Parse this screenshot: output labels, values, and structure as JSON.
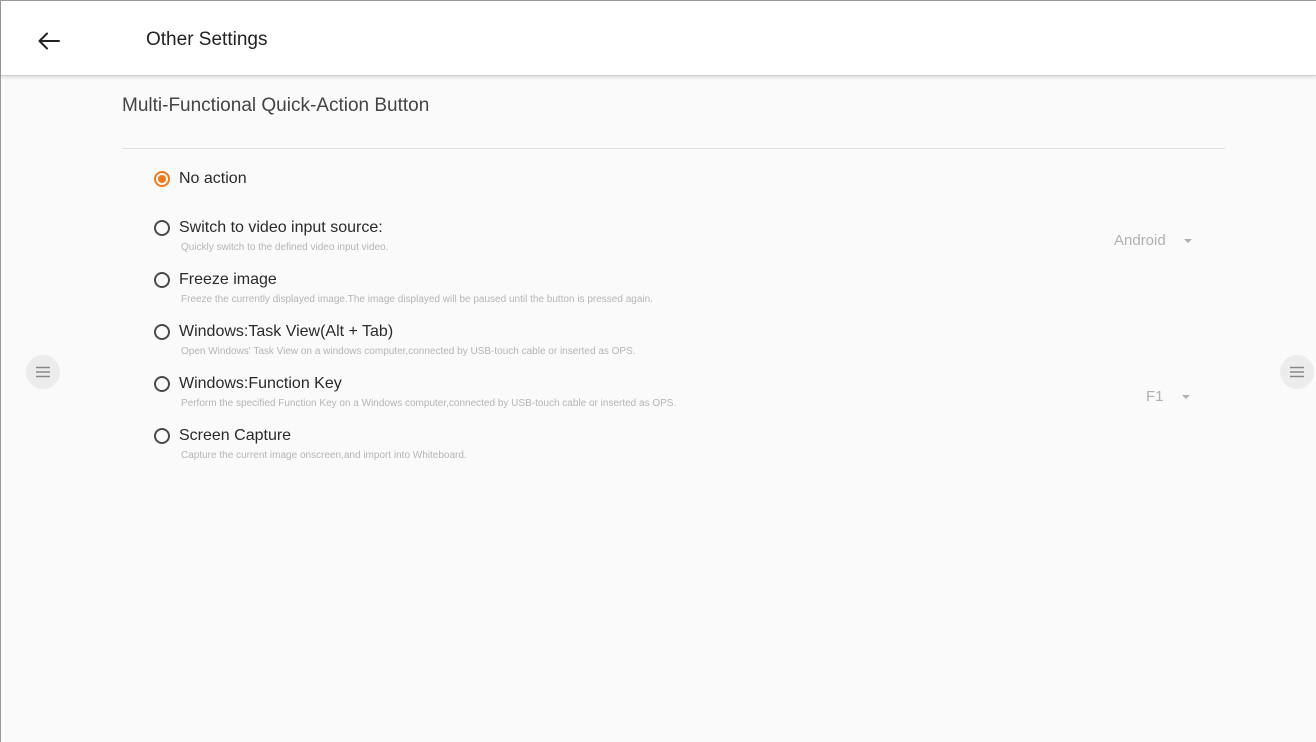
{
  "header": {
    "title": "Other Settings",
    "back_icon": "arrow-left-icon"
  },
  "section": {
    "title": "Multi-Functional Quick-Action Button"
  },
  "options": [
    {
      "label": "No action",
      "description": "",
      "selected": true
    },
    {
      "label": "Switch to video input source:",
      "description": "Quickly switch to the defined video input video.",
      "selected": false
    },
    {
      "label": "Freeze image",
      "description": "Freeze the currently displayed image.The image displayed will be paused until the button is pressed again.",
      "selected": false
    },
    {
      "label": "Windows:Task View(Alt + Tab)",
      "description": "Open Windows' Task View on a windows computer,connected by USB-touch cable or inserted as OPS.",
      "selected": false
    },
    {
      "label": "Windows:Function Key",
      "description": "Perform the specified Function Key on a Windows computer,connected by USB-touch cable or inserted as OPS.",
      "selected": false
    },
    {
      "label": "Screen Capture",
      "description": "Capture the current image onscreen,and import into Whiteboard.",
      "selected": false
    }
  ],
  "dropdowns": {
    "video_source": {
      "value": "Android"
    },
    "function_key": {
      "value": "F1"
    }
  },
  "side_buttons": {
    "left_icon": "menu-icon",
    "right_icon": "menu-icon"
  },
  "colors": {
    "accent": "#ef7a1a",
    "background": "#fafafa",
    "appbar": "#ffffff"
  }
}
